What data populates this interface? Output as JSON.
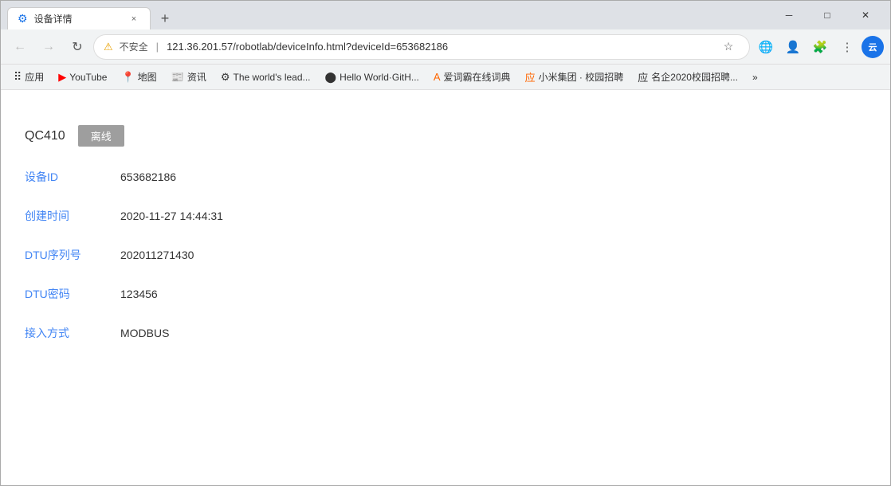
{
  "browser": {
    "title": "设备详情",
    "tab_close": "×",
    "new_tab": "+",
    "window_controls": {
      "minimize": "─",
      "maximize": "□",
      "close": "✕"
    },
    "nav": {
      "back": "←",
      "forward": "→",
      "refresh": "↻"
    },
    "address": {
      "security_label": "不安全",
      "url": "121.36.201.57/robotlab/deviceInfo.html?deviceId=653682186"
    },
    "actions": {
      "bookmark": "☆",
      "globe1": "🌐",
      "avatar": "👤",
      "extensions": "🧩",
      "menu": "⋮"
    },
    "bookmarks": [
      {
        "id": "apps",
        "label": "应用",
        "icon": "grid"
      },
      {
        "id": "youtube",
        "label": "YouTube",
        "icon": "yt"
      },
      {
        "id": "maps",
        "label": "地图",
        "icon": "map"
      },
      {
        "id": "news",
        "label": "资讯",
        "icon": "news"
      },
      {
        "id": "github",
        "label": "The world's lead...",
        "icon": "gh"
      },
      {
        "id": "github2",
        "label": "Hello World·GitH...",
        "icon": "gh2"
      },
      {
        "id": "dict",
        "label": "爱词霸在线词典",
        "icon": "dict"
      },
      {
        "id": "xiaomi",
        "label": "小米集团 · 校园招聘",
        "icon": "mi"
      },
      {
        "id": "jobs",
        "label": "名企2020校园招聘...",
        "icon": "job"
      },
      {
        "id": "more",
        "label": "»",
        "icon": "more"
      }
    ]
  },
  "page": {
    "device_name": "QC410",
    "status_label": "离线",
    "fields": [
      {
        "label": "设备ID",
        "value": "653682186"
      },
      {
        "label": "创建时间",
        "value": "2020-11-27 14:44:31"
      },
      {
        "label": "DTU序列号",
        "value": "202011271430"
      },
      {
        "label": "DTU密码",
        "value": "123456"
      },
      {
        "label": "接入方式",
        "value": "MODBUS"
      }
    ]
  }
}
